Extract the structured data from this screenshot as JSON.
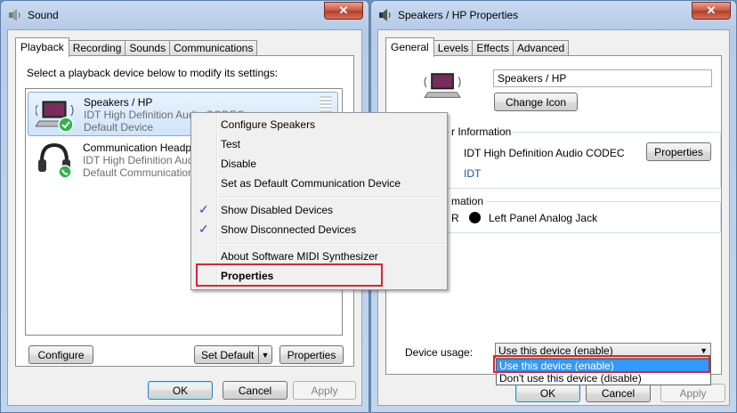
{
  "sound_window": {
    "title": "Sound",
    "close_label": "✕",
    "tabs": [
      {
        "label": "Playback"
      },
      {
        "label": "Recording"
      },
      {
        "label": "Sounds"
      },
      {
        "label": "Communications"
      }
    ],
    "instruction": "Select a playback device below to modify its settings:",
    "devices": [
      {
        "name": "Speakers / HP",
        "line1": "IDT High Definition Audio CODEC",
        "line2": "Default Device",
        "icon": "laptop-speaker-icon",
        "status_icon": "green-check-icon"
      },
      {
        "name": "Communication Headphones",
        "line1": "IDT High Definition Audio CODEC",
        "line2": "Default Communication Device",
        "icon": "headphones-icon",
        "status_icon": "green-phone-icon"
      }
    ],
    "buttons": {
      "configure": "Configure",
      "set_default": "Set Default",
      "set_default_arrow": "▼",
      "properties": "Properties",
      "ok": "OK",
      "cancel": "Cancel",
      "apply": "Apply"
    }
  },
  "context_menu": {
    "items": [
      {
        "label": "Configure Speakers"
      },
      {
        "label": "Test"
      },
      {
        "label": "Disable"
      },
      {
        "label": "Set as Default Communication Device"
      },
      {
        "label": "Show Disabled Devices",
        "checked": true
      },
      {
        "label": "Show Disconnected Devices",
        "checked": true
      },
      {
        "label": "About Software MIDI Synthesizer"
      },
      {
        "label": "Properties",
        "bold": true
      }
    ],
    "check_glyph": "✓"
  },
  "properties_window": {
    "title": "Speakers / HP Properties",
    "close_label": "✕",
    "tabs": [
      {
        "label": "General"
      },
      {
        "label": "Levels"
      },
      {
        "label": "Effects"
      },
      {
        "label": "Advanced"
      }
    ],
    "device_name_value": "Speakers / HP",
    "change_icon_label": "Change Icon",
    "controller_group_title": "r Information",
    "controller_name": "IDT High Definition Audio CODEC",
    "controller_properties_label": "Properties",
    "controller_vendor": "IDT",
    "jack_group_title": "mation",
    "jack_prefix": "R",
    "jack_label": "Left Panel Analog Jack",
    "device_usage_label": "Device usage:",
    "device_usage_value": "Use this device (enable)",
    "device_usage_options": [
      "Use this device (enable)",
      "Don't use this device (disable)"
    ],
    "buttons": {
      "ok": "OK",
      "cancel": "Cancel",
      "apply": "Apply"
    }
  },
  "colors": {
    "highlight_red": "#d7262f",
    "selection_blue": "#3399ff",
    "link_blue": "#1f4fb4"
  }
}
